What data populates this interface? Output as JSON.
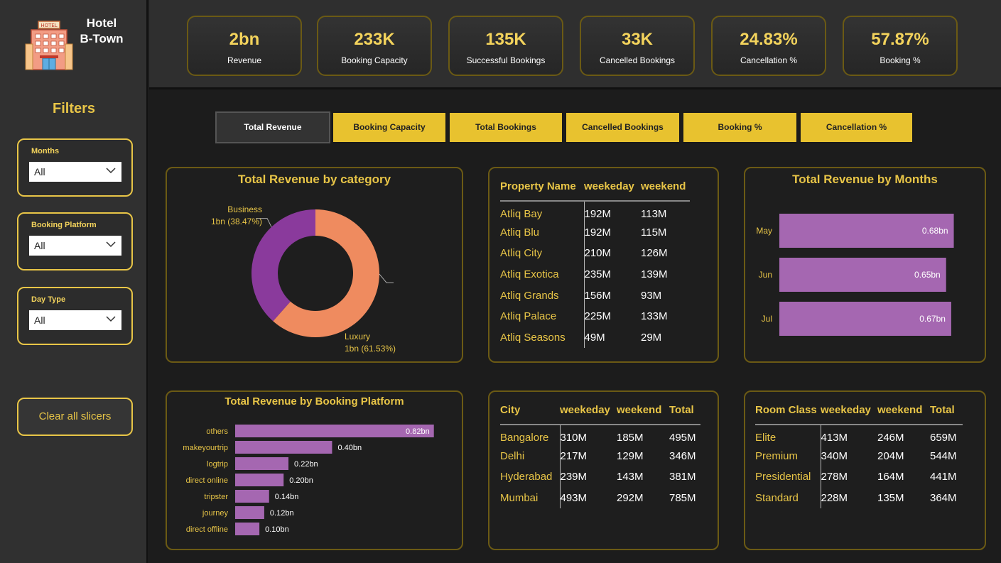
{
  "brand": {
    "line1": "Hotel",
    "line2": "B-Town",
    "logo_icon": "hotel-building-icon",
    "logo_sign": "HOTEL"
  },
  "filters": {
    "title": "Filters",
    "slicers": [
      {
        "label": "Months",
        "value": "All"
      },
      {
        "label": "Booking Platform",
        "value": "All"
      },
      {
        "label": "Day Type",
        "value": "All"
      }
    ],
    "clear_label": "Clear all slicers"
  },
  "kpis": [
    {
      "value": "2bn",
      "label": "Revenue"
    },
    {
      "value": "233K",
      "label": "Booking Capacity"
    },
    {
      "value": "135K",
      "label": "Successful Bookings"
    },
    {
      "value": "33K",
      "label": "Cancelled Bookings"
    },
    {
      "value": "24.83%",
      "label": "Cancellation %"
    },
    {
      "value": "57.87%",
      "label": "Booking %"
    }
  ],
  "nav": {
    "active": "Total Revenue",
    "buttons": [
      "Total Revenue",
      "Booking Capacity",
      "Total Bookings",
      "Cancelled Bookings",
      "Booking %",
      "Cancellation %"
    ]
  },
  "colors": {
    "accent": "#e8c547",
    "bar": "#a567b1",
    "donut_business": "#8a3a9c",
    "donut_luxury": "#ef8b5f"
  },
  "chart_data": [
    {
      "type": "pie",
      "title": "Total Revenue by category",
      "categories": [
        "Business",
        "Luxury"
      ],
      "values": [
        38.47,
        61.53
      ],
      "labels": [
        "1bn (38.47%)",
        "1bn (61.53%)"
      ]
    },
    {
      "type": "bar",
      "title": "Total Revenue by Months",
      "categories": [
        "May",
        "Jun",
        "Jul"
      ],
      "values": [
        0.68,
        0.65,
        0.67
      ],
      "data_labels": [
        "0.68bn",
        "0.65bn",
        "0.67bn"
      ]
    },
    {
      "type": "bar",
      "title": "Total Revenue by Booking Platform",
      "categories": [
        "others",
        "makeyourtrip",
        "logtrip",
        "direct online",
        "tripster",
        "journey",
        "direct offline"
      ],
      "values": [
        0.82,
        0.4,
        0.22,
        0.2,
        0.14,
        0.12,
        0.1
      ],
      "data_labels": [
        "0.82bn",
        "0.40bn",
        "0.22bn",
        "0.20bn",
        "0.14bn",
        "0.12bn",
        "0.10bn"
      ]
    }
  ],
  "tables": {
    "property": {
      "headers": [
        "Property Name",
        "weekeday",
        "weekend"
      ],
      "rows": [
        [
          "Atliq Bay",
          "192M",
          "113M"
        ],
        [
          "Atliq Blu",
          "192M",
          "115M"
        ],
        [
          "Atliq City",
          "210M",
          "126M"
        ],
        [
          "Atliq Exotica",
          "235M",
          "139M"
        ],
        [
          "Atliq Grands",
          "156M",
          "93M"
        ],
        [
          "Atliq Palace",
          "225M",
          "133M"
        ],
        [
          "Atliq Seasons",
          "49M",
          "29M"
        ]
      ]
    },
    "city": {
      "headers": [
        "City",
        "weekeday",
        "weekend",
        "Total"
      ],
      "rows": [
        [
          "Bangalore",
          "310M",
          "185M",
          "495M"
        ],
        [
          "Delhi",
          "217M",
          "129M",
          "346M"
        ],
        [
          "Hyderabad",
          "239M",
          "143M",
          "381M"
        ],
        [
          "Mumbai",
          "493M",
          "292M",
          "785M"
        ]
      ]
    },
    "room": {
      "headers": [
        "Room Class",
        "weekeday",
        "weekend",
        "Total"
      ],
      "rows": [
        [
          "Elite",
          "413M",
          "246M",
          "659M"
        ],
        [
          "Premium",
          "340M",
          "204M",
          "544M"
        ],
        [
          "Presidential",
          "278M",
          "164M",
          "441M"
        ],
        [
          "Standard",
          "228M",
          "135M",
          "364M"
        ]
      ]
    }
  }
}
